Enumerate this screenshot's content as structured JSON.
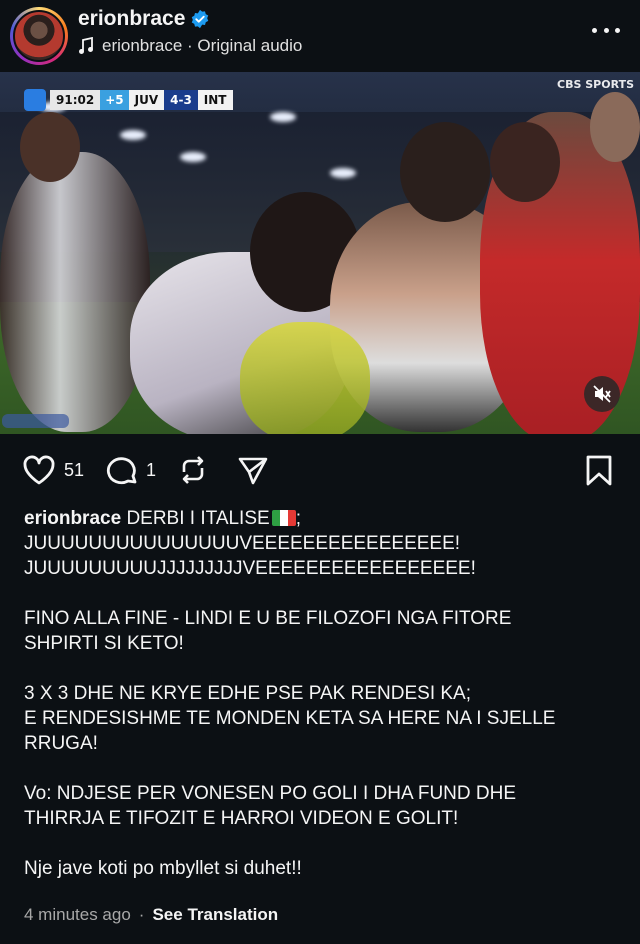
{
  "header": {
    "username": "erionbrace",
    "verified_icon": "verified-badge-icon",
    "audio_icon": "music-note-icon",
    "audio_text": "erionbrace · Original audio",
    "more_icon": "more-horizontal-icon"
  },
  "media": {
    "scorebug": {
      "time": "91:02",
      "added": "+5",
      "home": "JUV",
      "score": "4-3",
      "away": "INT"
    },
    "broadcaster": "CBS SPORTS",
    "mute_icon": "speaker-muted-icon"
  },
  "actions": {
    "like_icon": "heart-icon",
    "like_count": "51",
    "comment_icon": "comment-icon",
    "comment_count": "1",
    "repost_icon": "repost-icon",
    "share_icon": "send-icon",
    "save_icon": "bookmark-icon"
  },
  "caption": {
    "username": "erionbrace",
    "line1": "DERBI I ITALISE",
    "line1_end": ";",
    "line2": "JUUUUUUUUUUUUUUUVEEEEEEEEEEEEEEEE!",
    "line3": "JUUUUUUUUUJJJJJJJJJVEEEEEEEEEEEEEEEEE!",
    "para2": [
      "FINO ALLA FINE - LINDI E U BE FILOZOFI NGA FITORE",
      "SHPIRTI SI KETO!"
    ],
    "para3": [
      "3 X 3 DHE NE KRYE EDHE PSE PAK RENDESI KA;",
      "E RENDESISHME TE MONDEN KETA SA HERE NA I SJELLE",
      "RRUGA!"
    ],
    "para4": [
      "Vo: NDJESE PER VONESEN PO GOLI I DHA FUND DHE",
      "THIRRJA E TIFOZIT E HARROI VIDEON E GOLIT!"
    ],
    "para5": "Nje jave koti po mbyllet si duhet!!"
  },
  "meta": {
    "time": "4 minutes ago",
    "separator": "·",
    "translate": "See Translation"
  },
  "colors": {
    "background": "#0c1014",
    "text": "#f5f5f5",
    "muted_text": "#a8a8a8",
    "verified": "#1d9bf0"
  }
}
